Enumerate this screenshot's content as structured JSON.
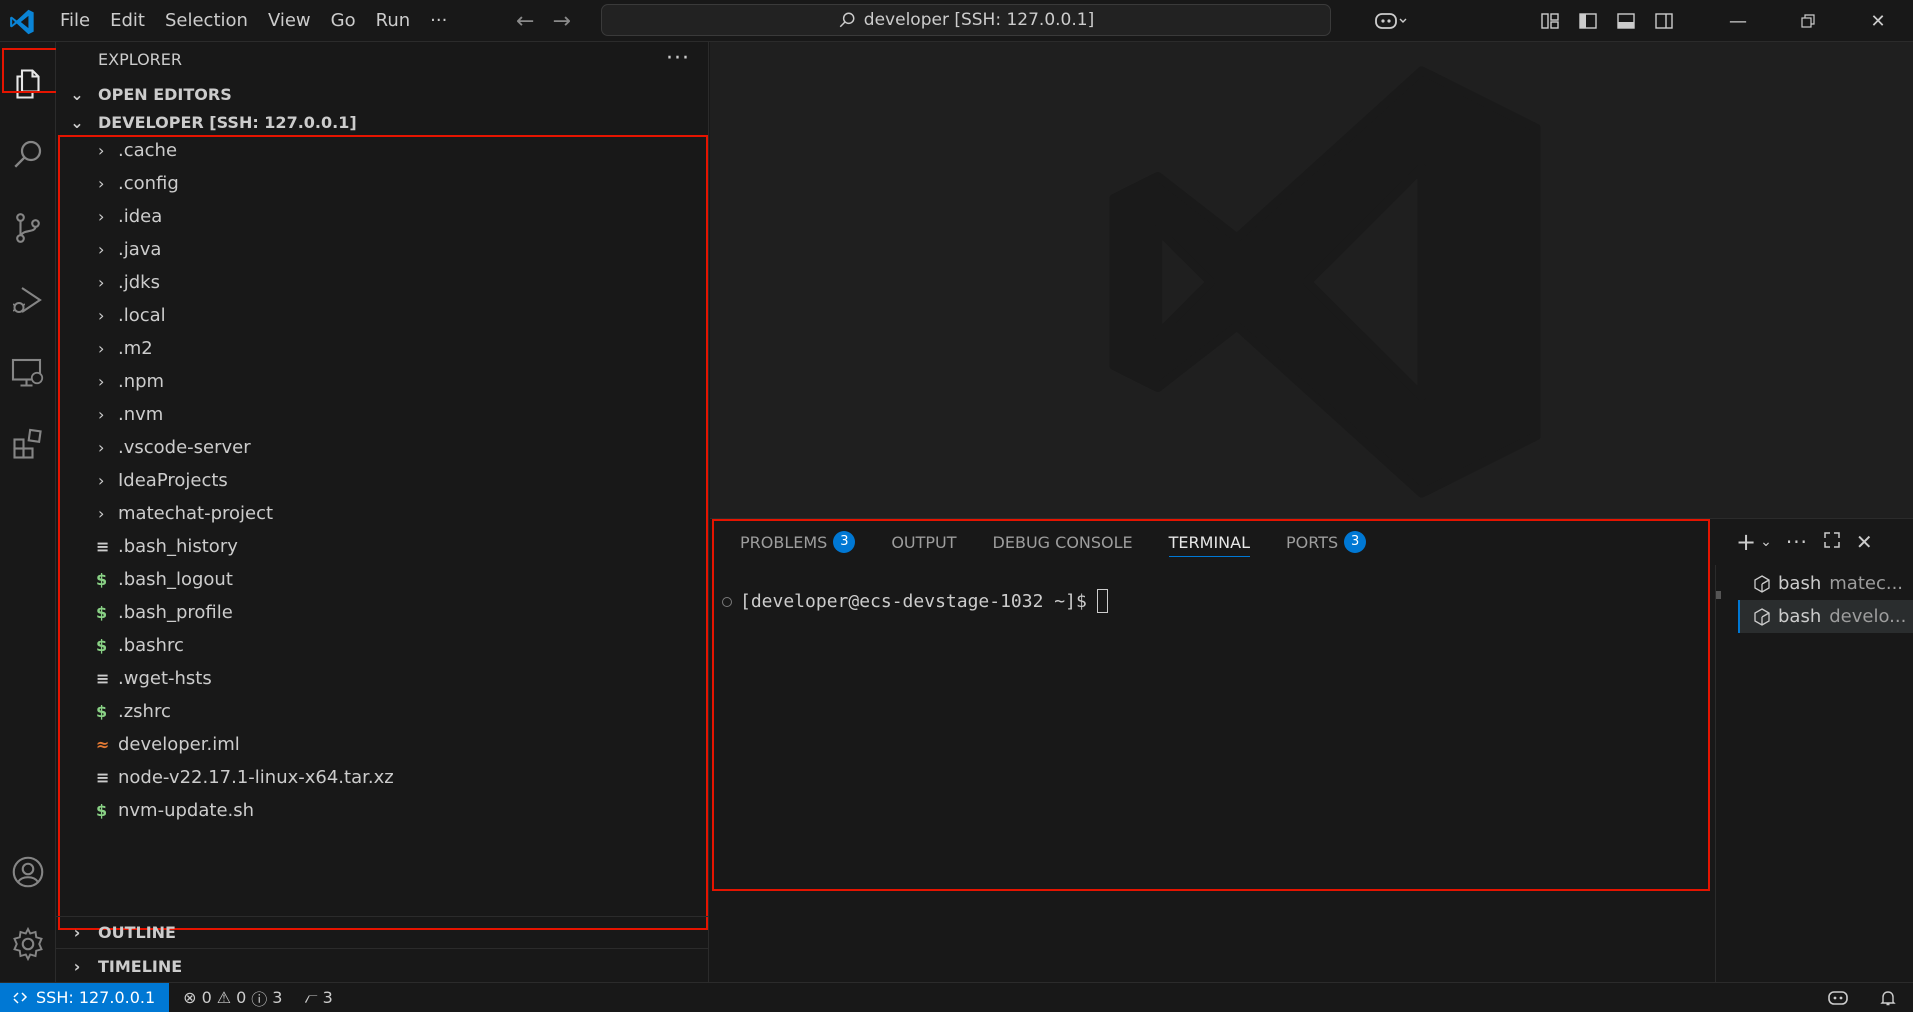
{
  "titlebar": {
    "menu": [
      "File",
      "Edit",
      "Selection",
      "View",
      "Go",
      "Run",
      "···"
    ],
    "command_center": "developer [SSH: 127.0.0.1]"
  },
  "sidebar": {
    "title": "EXPLORER",
    "more": "···",
    "open_editors": "OPEN EDITORS",
    "workspace": "DEVELOPER [SSH: 127.0.0.1]",
    "folders": [
      ".cache",
      ".config",
      ".idea",
      ".java",
      ".jdks",
      ".local",
      ".m2",
      ".npm",
      ".nvm",
      ".vscode-server",
      "IdeaProjects",
      "matechat-project"
    ],
    "files": [
      ".bash_history",
      ".bash_logout",
      ".bash_profile",
      ".bashrc",
      ".wget-hsts",
      ".zshrc",
      "developer.iml",
      "node-v22.17.1-linux-x64.tar.xz",
      "nvm-update.sh"
    ],
    "outline": "OUTLINE",
    "timeline": "TIMELINE"
  },
  "panel": {
    "tabs": {
      "problems": "PROBLEMS",
      "problems_count": "3",
      "output": "OUTPUT",
      "debug": "DEBUG CONSOLE",
      "terminal": "TERMINAL",
      "ports": "PORTS",
      "ports_count": "3"
    },
    "prompt": "[developer@ecs-devstage-1032 ~]$",
    "terminals": [
      {
        "name": "bash",
        "desc": "matec..."
      },
      {
        "name": "bash",
        "desc": "develo..."
      }
    ]
  },
  "statusbar": {
    "remote": "SSH: 127.0.0.1",
    "errors": "0",
    "warnings": "0",
    "infos": "3",
    "ports": "3"
  }
}
